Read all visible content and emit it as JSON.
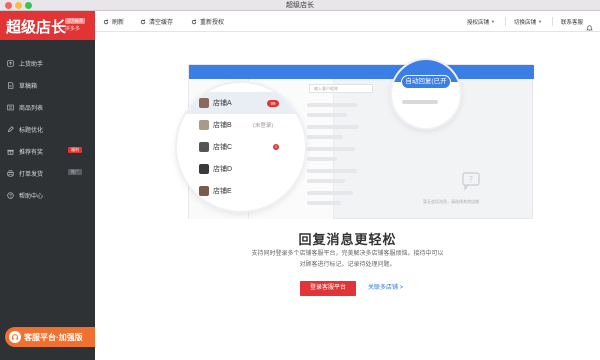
{
  "window": {
    "title": "超级店长"
  },
  "sidebar": {
    "logo_title": "超级店长",
    "logo_badge": "官方推荐",
    "logo_sub": "拼多多",
    "items": [
      {
        "label": "上货助手",
        "icon": "upload-icon"
      },
      {
        "label": "草稿箱",
        "icon": "draft-icon"
      },
      {
        "label": "商品列表",
        "icon": "list-icon"
      },
      {
        "label": "标题优化",
        "icon": "edit-icon"
      },
      {
        "label": "推荐有奖",
        "icon": "gift-icon",
        "badge": "福利"
      },
      {
        "label": "打单发货",
        "icon": "print-icon",
        "badge": "推广"
      },
      {
        "label": "帮助中心",
        "icon": "help-icon"
      }
    ],
    "promo_label": "客服平台·加强版"
  },
  "toolbar": {
    "refresh": "刷新",
    "clear_cache": "清空缓存",
    "reauth": "重新授权",
    "auth_store": "授权店铺",
    "switch_store": "切换店铺",
    "contact": "联系客服"
  },
  "illustration": {
    "search_placeholder": "输入客户昵称",
    "empty_hint": "暂无会话消息，请选择其他店铺",
    "autoreply": "自动回复(已开启)",
    "stores": [
      {
        "name": "店铺A",
        "badge": "99"
      },
      {
        "name": "店铺B",
        "status": "(未登录)"
      },
      {
        "name": "店铺C",
        "badge": "2"
      },
      {
        "name": "店铺D"
      },
      {
        "name": "店铺E"
      }
    ]
  },
  "main": {
    "headline": "回复消息更轻松",
    "desc_line1": "支持同时登录多个店铺客服平台，完美解决多店铺客服烦恼。接待中可以",
    "desc_line2": "对顾客进行标记，记录待处理问题。",
    "login_button": "登录客服平台",
    "link": "关联多店铺 >"
  },
  "colors": {
    "brand": "#e23434",
    "accent": "#3b7ee6",
    "sidebar": "#2f3235",
    "promo": "#f07030"
  }
}
